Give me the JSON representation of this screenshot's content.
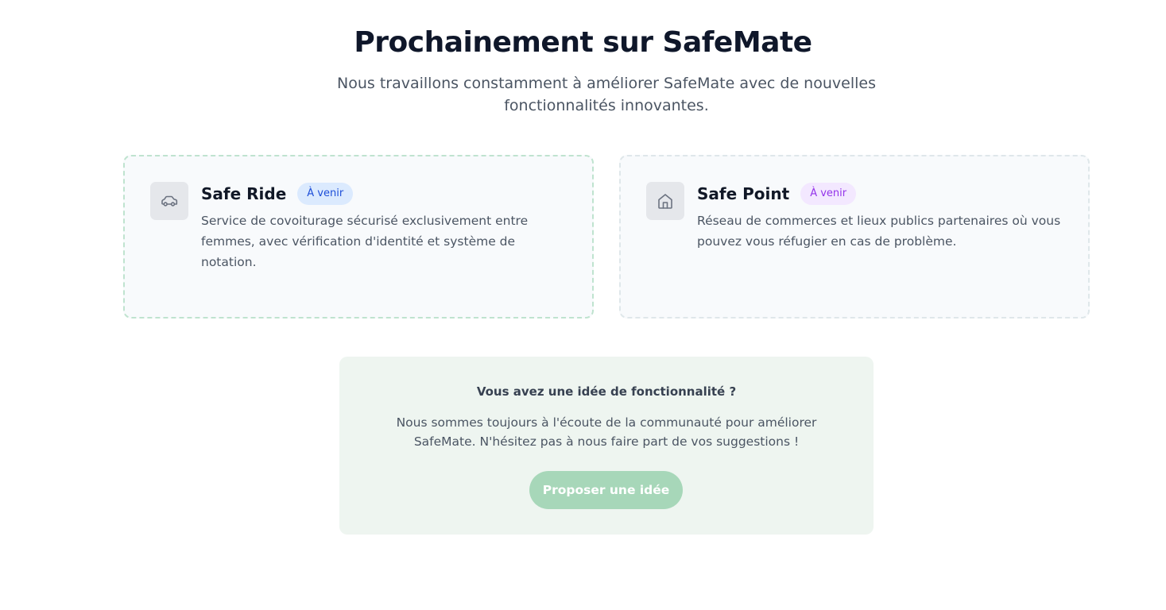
{
  "section": {
    "title": "Prochainement sur SafeMate",
    "subtitle": "Nous travaillons constamment à améliorer SafeMate avec de nouvelles fonctionnalités innovantes."
  },
  "features": [
    {
      "icon": "car-icon",
      "title": "Safe Ride",
      "badge": "À venir",
      "badge_color": "#1d4ed8",
      "description": "Service de covoiturage sécurisé exclusivement entre femmes, avec vérification d'identité et système de notation."
    },
    {
      "icon": "home-icon",
      "title": "Safe Point",
      "badge": "À venir",
      "badge_color": "#9333ea",
      "description": "Réseau de commerces et lieux publics partenaires où vous pouvez vous réfugier en cas de problème."
    }
  ],
  "idea": {
    "title": "Vous avez une idée de fonctionnalité ?",
    "text": "Nous sommes toujours à l'écoute de la communauté pour améliorer SafeMate. N'hésitez pas à nous faire part de vos suggestions !",
    "button_label": "Proposer une idée",
    "button_color": "#a7d7b9"
  }
}
